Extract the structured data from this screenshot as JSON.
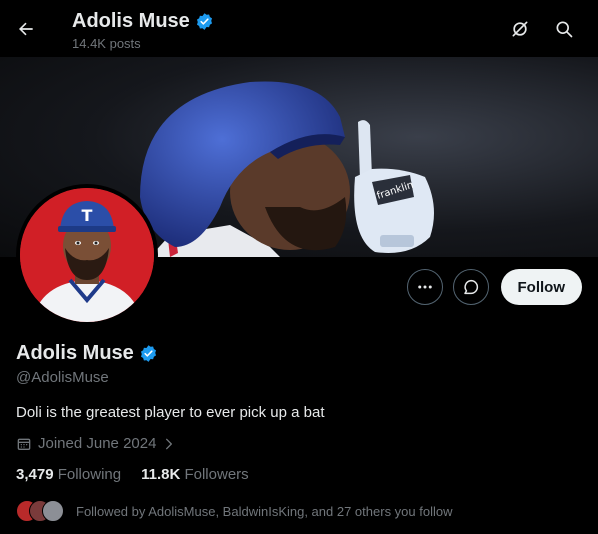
{
  "header": {
    "name": "Adolis Muse",
    "posts": "14.4K posts"
  },
  "actions": {
    "follow_label": "Follow"
  },
  "profile": {
    "name": "Adolis Muse",
    "handle": "@AdolisMuse",
    "bio": "Doli is the greatest player to ever pick up a bat",
    "joined": "Joined June 2024",
    "following_count": "3,479",
    "following_label": "Following",
    "followers_count": "11.8K",
    "followers_label": "Followers",
    "followed_by": "Followed by AdolisMuse, BaldwinIsKing, and 27 others you follow"
  },
  "colors": {
    "verified": "#1d9bf0",
    "background": "#000000",
    "muted_text": "#71767b",
    "avatar_bg": "#d11f26"
  },
  "icons": {
    "back": "arrow-left-icon",
    "verified": "verified-badge-icon",
    "grok": "grok-icon",
    "search": "search-icon",
    "more": "more-icon",
    "message": "message-icon",
    "calendar": "calendar-icon",
    "chevron": "chevron-right-icon"
  }
}
